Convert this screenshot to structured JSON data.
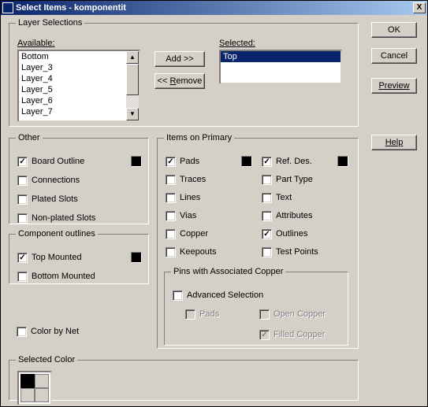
{
  "window": {
    "title": "Select Items - komponentit"
  },
  "buttons": {
    "ok": "OK",
    "cancel": "Cancel",
    "preview": "Preview",
    "help": "Help",
    "add": "Add >>",
    "remove": "<< Remove",
    "close": "X"
  },
  "layerSelections": {
    "legend": "Layer Selections",
    "availableLabel": "Available:",
    "selectedLabel": "Selected:",
    "available": [
      "Bottom",
      "Layer_3",
      "Layer_4",
      "Layer_5",
      "Layer_6",
      "Layer_7"
    ],
    "selected": [
      "Top"
    ]
  },
  "other": {
    "legend": "Other",
    "items": [
      {
        "label": "Board Outline",
        "checked": true,
        "swatch": "#000000"
      },
      {
        "label": "Connections",
        "checked": false
      },
      {
        "label": "Plated Slots",
        "checked": false
      },
      {
        "label": "Non-plated Slots",
        "checked": false
      }
    ]
  },
  "componentOutlines": {
    "legend": "Component outlines",
    "items": [
      {
        "label": "Top Mounted",
        "checked": true,
        "swatch": "#000000"
      },
      {
        "label": "Bottom Mounted",
        "checked": false
      }
    ]
  },
  "colorByNet": {
    "label": "Color by Net",
    "checked": false
  },
  "itemsOnPrimary": {
    "legend": "Items on Primary",
    "col1": [
      {
        "label": "Pads",
        "checked": true,
        "swatch": "#000000"
      },
      {
        "label": "Traces",
        "checked": false
      },
      {
        "label": "Lines",
        "checked": false
      },
      {
        "label": "Vias",
        "checked": false
      },
      {
        "label": "Copper",
        "checked": false
      },
      {
        "label": "Keepouts",
        "checked": false
      }
    ],
    "col2": [
      {
        "label": "Ref. Des.",
        "checked": true,
        "swatch": "#000000"
      },
      {
        "label": "Part Type",
        "checked": false
      },
      {
        "label": "Text",
        "checked": false
      },
      {
        "label": "Attributes",
        "checked": false
      },
      {
        "label": "Outlines",
        "checked": true
      },
      {
        "label": "Test Points",
        "checked": false
      }
    ]
  },
  "pinsCopper": {
    "legend": "Pins with Associated Copper",
    "advanced": {
      "label": "Advanced Selection",
      "checked": false
    },
    "sub": [
      {
        "label": "Pads",
        "checked": false,
        "disabled": true
      },
      {
        "label": "Open Copper",
        "checked": false,
        "disabled": true
      },
      {
        "label": "Filled Copper",
        "checked": true,
        "disabled": true
      }
    ]
  },
  "selectedColor": {
    "legend": "Selected Color"
  }
}
